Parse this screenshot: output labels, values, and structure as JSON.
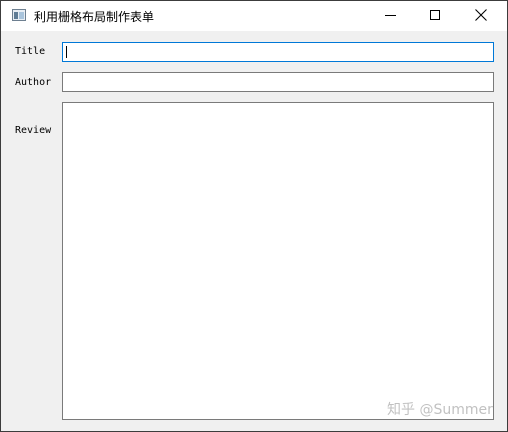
{
  "window": {
    "title": "利用栅格布局制作表单",
    "controls": {
      "minimize_icon": "minimize-icon",
      "maximize_icon": "maximize-icon",
      "close_icon": "close-icon"
    }
  },
  "form": {
    "title_label": "Title",
    "title_value": "",
    "author_label": "Author",
    "author_value": "",
    "review_label": "Review",
    "review_value": ""
  },
  "watermark": "知乎 @Summer",
  "colors": {
    "focus_border": "#0078d7",
    "window_bg": "#f0f0f0"
  }
}
